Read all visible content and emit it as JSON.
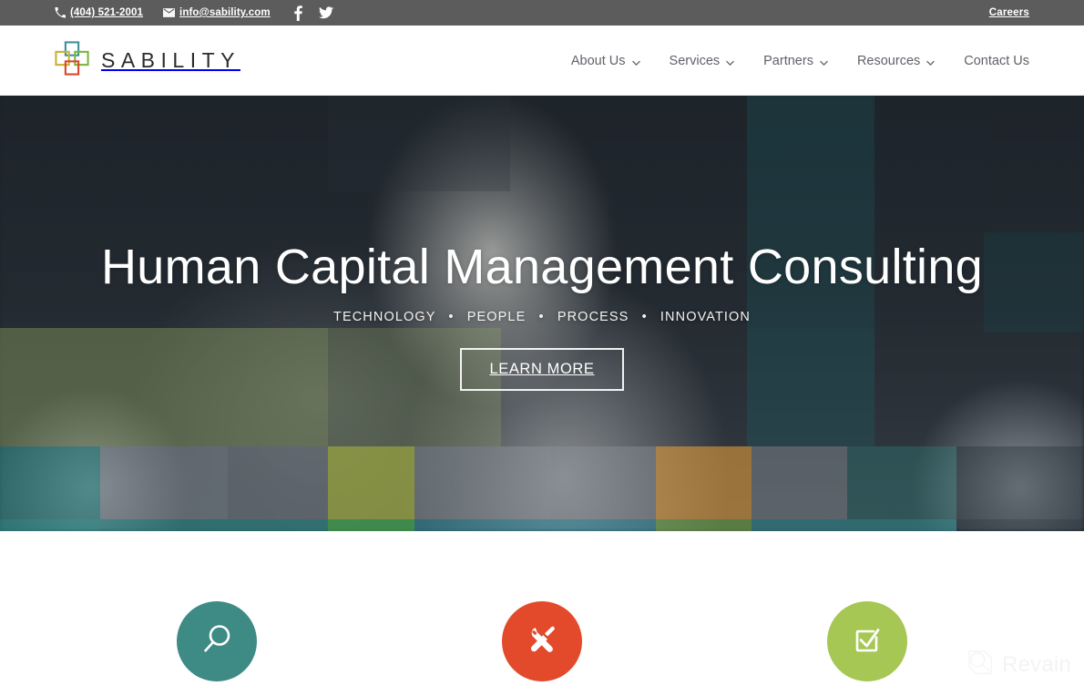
{
  "topbar": {
    "phone": "(404) 521-2001",
    "email": "info@sability.com",
    "social": [
      {
        "name": "facebook-icon",
        "label": "Facebook"
      },
      {
        "name": "twitter-icon",
        "label": "Twitter"
      }
    ],
    "careers_label": "Careers",
    "background_color": "#5c5c5c"
  },
  "header": {
    "brand_name": "SABILITY",
    "logo_colors": {
      "top": "#3f8f9d",
      "left": "#c9b037",
      "right": "#7cb342",
      "bottom": "#d9462a"
    },
    "nav": [
      {
        "label": "About Us",
        "has_dropdown": true
      },
      {
        "label": "Services",
        "has_dropdown": true
      },
      {
        "label": "Partners",
        "has_dropdown": true
      },
      {
        "label": "Resources",
        "has_dropdown": true
      },
      {
        "label": "Contact Us",
        "has_dropdown": false
      }
    ]
  },
  "hero": {
    "title": "Human Capital Management Consulting",
    "subtitle_parts": [
      "TECHNOLOGY",
      "PEOPLE",
      "PROCESS",
      "INNOVATION"
    ],
    "subtitle": "TECHNOLOGY • PEOPLE • PROCESS • INNOVATION",
    "button_label": "LEARN MORE",
    "overlay_colors": {
      "teal": "#2f8f8a",
      "green": "#4aa94f",
      "olive": "#b5bf44",
      "orange": "#e09b3a",
      "gray": "#8d9197",
      "dark": "#1d2730"
    }
  },
  "features": [
    {
      "icon": "search-icon",
      "color": "#3e8a85"
    },
    {
      "icon": "tools-icon",
      "color": "#e24a2b"
    },
    {
      "icon": "checkbox-check-icon",
      "color": "#a6c754"
    }
  ],
  "watermark": {
    "text": "Revain",
    "icon": "revain-logo-icon"
  }
}
